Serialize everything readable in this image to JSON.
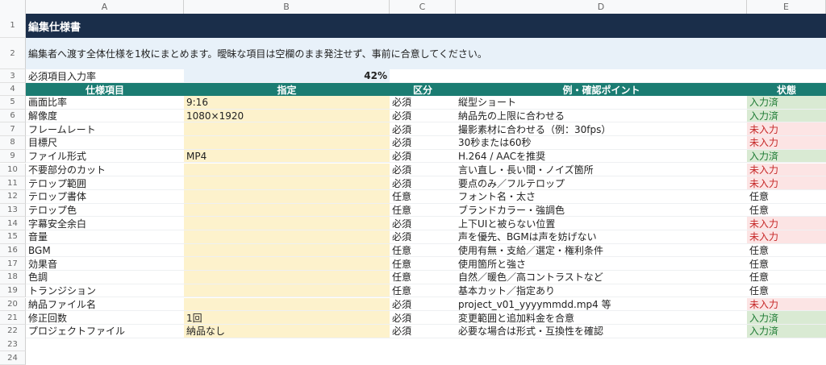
{
  "columns": [
    "A",
    "B",
    "C",
    "D",
    "E"
  ],
  "row_numbers": [
    "1",
    "2",
    "3",
    "4",
    "5",
    "6",
    "7",
    "8",
    "9",
    "10",
    "11",
    "12",
    "13",
    "14",
    "15",
    "16",
    "17",
    "18",
    "19",
    "20",
    "21",
    "22",
    "23",
    "24"
  ],
  "title": "編集仕様書",
  "description": "編集者へ渡す全体仕様を1枚にまとめます。曖昧な項目は空欄のまま発注せず、事前に合意してください。",
  "rate": {
    "label": "必須項目入力率",
    "value": "42%"
  },
  "headers": [
    "仕様項目",
    "指定",
    "区分",
    "例・確認ポイント",
    "状態"
  ],
  "rows": [
    {
      "item": "画面比率",
      "spec": "9:16",
      "kubun": "必須",
      "example": "縦型ショート",
      "status": "入力済",
      "status_type": "done"
    },
    {
      "item": "解像度",
      "spec": "1080×1920",
      "kubun": "必須",
      "example": "納品先の上限に合わせる",
      "status": "入力済",
      "status_type": "done"
    },
    {
      "item": "フレームレート",
      "spec": "",
      "kubun": "必須",
      "example": "撮影素材に合わせる（例：30fps）",
      "status": "未入力",
      "status_type": "todo"
    },
    {
      "item": "目標尺",
      "spec": "",
      "kubun": "必須",
      "example": "30秒または60秒",
      "status": "未入力",
      "status_type": "todo"
    },
    {
      "item": "ファイル形式",
      "spec": "MP4",
      "kubun": "必須",
      "example": "H.264 / AACを推奨",
      "status": "入力済",
      "status_type": "done"
    },
    {
      "item": "不要部分のカット",
      "spec": "",
      "kubun": "必須",
      "example": "言い直し・長い間・ノイズ箇所",
      "status": "未入力",
      "status_type": "todo"
    },
    {
      "item": "テロップ範囲",
      "spec": "",
      "kubun": "必須",
      "example": "要点のみ／フルテロップ",
      "status": "未入力",
      "status_type": "todo"
    },
    {
      "item": "テロップ書体",
      "spec": "",
      "kubun": "任意",
      "example": "フォント名・太さ",
      "status": "任意",
      "status_type": "opt"
    },
    {
      "item": "テロップ色",
      "spec": "",
      "kubun": "任意",
      "example": "ブランドカラー・強調色",
      "status": "任意",
      "status_type": "opt"
    },
    {
      "item": "字幕安全余白",
      "spec": "",
      "kubun": "必須",
      "example": "上下UIと被らない位置",
      "status": "未入力",
      "status_type": "todo"
    },
    {
      "item": "音量",
      "spec": "",
      "kubun": "必須",
      "example": "声を優先、BGMは声を妨げない",
      "status": "未入力",
      "status_type": "todo"
    },
    {
      "item": "BGM",
      "spec": "",
      "kubun": "任意",
      "example": "使用有無・支給／選定・権利条件",
      "status": "任意",
      "status_type": "opt"
    },
    {
      "item": "効果音",
      "spec": "",
      "kubun": "任意",
      "example": "使用箇所と強さ",
      "status": "任意",
      "status_type": "opt"
    },
    {
      "item": "色調",
      "spec": "",
      "kubun": "任意",
      "example": "自然／暖色／高コントラストなど",
      "status": "任意",
      "status_type": "opt"
    },
    {
      "item": "トランジション",
      "spec": "",
      "kubun": "任意",
      "example": "基本カット／指定あり",
      "status": "任意",
      "status_type": "opt"
    },
    {
      "item": "納品ファイル名",
      "spec": "",
      "kubun": "必須",
      "example": "project_v01_yyyymmdd.mp4 等",
      "status": "未入力",
      "status_type": "todo"
    },
    {
      "item": "修正回数",
      "spec": "1回",
      "kubun": "必須",
      "example": "変更範囲と追加料金を合意",
      "status": "入力済",
      "status_type": "done"
    },
    {
      "item": "プロジェクトファイル",
      "spec": "納品なし",
      "kubun": "必須",
      "example": "必要な場合は形式・互換性を確認",
      "status": "入力済",
      "status_type": "done"
    }
  ],
  "colors": {
    "title_bg": "#1a2e4a",
    "header_bg": "#1b7c72",
    "desc_bg": "#e8f1f9",
    "spec_bg": "#fdf2cc",
    "done_bg": "#d9ead3",
    "todo_bg": "#fce4e4"
  }
}
